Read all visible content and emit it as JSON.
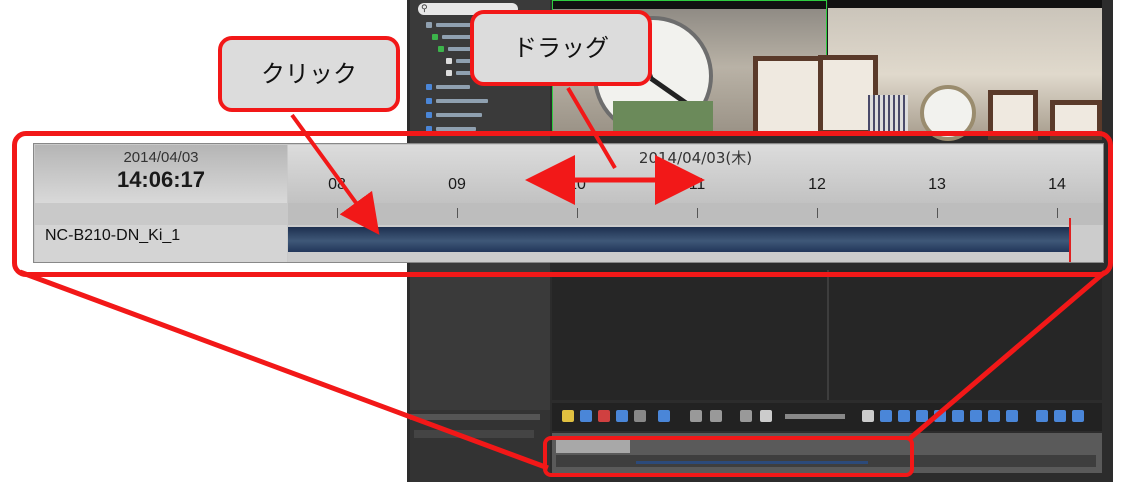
{
  "timeline": {
    "date": "2014/04/03",
    "time": "14:06:17",
    "day_header": "2014/04/03(木)",
    "hours": [
      "08",
      "09",
      "10",
      "11",
      "12",
      "13",
      "14"
    ],
    "camera": "NC-B210-DN_Ki_1"
  },
  "callouts": {
    "click": "クリック",
    "drag": "ドラッグ"
  },
  "colors": {
    "annotation_red": "#f21818",
    "recording_bar": "#2f4668",
    "current_time_marker": "#e02020"
  },
  "icons": [
    "search-icon",
    "play-icon",
    "pause-icon",
    "zoom-icon",
    "camera-icon"
  ]
}
